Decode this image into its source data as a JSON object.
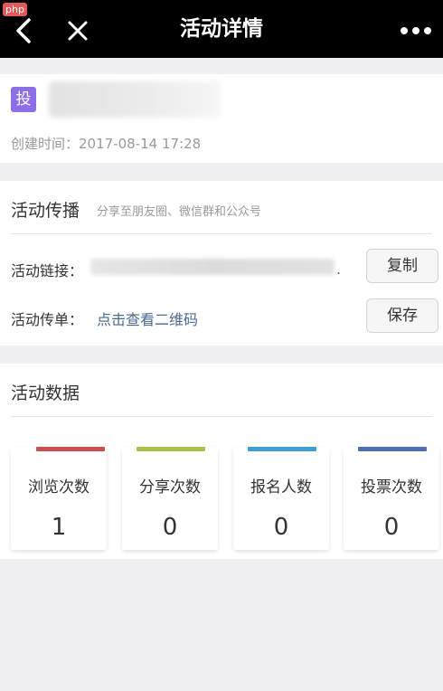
{
  "nav": {
    "title": "活动详情",
    "badge": "php"
  },
  "activity": {
    "type_badge": "投",
    "created_label": "创建时间：",
    "created_time": "2017-08-14 17:28"
  },
  "share": {
    "title": "活动传播",
    "subtitle": "分享至朋友圈、微信群和公众号",
    "link_label": "活动链接：",
    "copy_label": "复制",
    "flyer_label": "活动传单：",
    "qr_text": "点击查看二维码",
    "save_label": "保存"
  },
  "stats": {
    "title": "活动数据",
    "items": [
      {
        "label": "浏览次数",
        "value": "1",
        "color": "#c9504f"
      },
      {
        "label": "分享次数",
        "value": "0",
        "color": "#a8c04a"
      },
      {
        "label": "报名人数",
        "value": "0",
        "color": "#3d9fd6"
      },
      {
        "label": "投票次数",
        "value": "0",
        "color": "#4e6fb0"
      }
    ]
  },
  "icons": {
    "back": "chevron-left-icon",
    "close": "close-icon",
    "more": "more-dots-icon"
  }
}
